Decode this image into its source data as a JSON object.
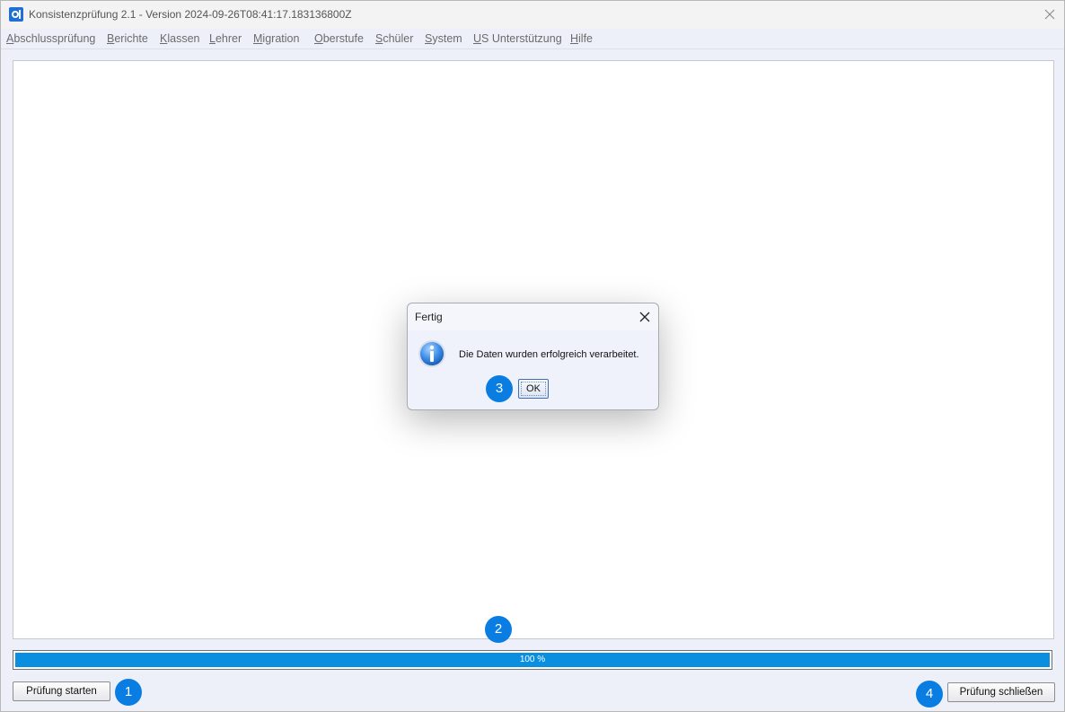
{
  "window": {
    "title": "Konsistenzprüfung 2.1 - Version 2024-09-26T08:41:17.183136800Z"
  },
  "menu": {
    "items": [
      {
        "mnemonic": "A",
        "rest": "bschlussprüfung"
      },
      {
        "mnemonic": "B",
        "rest": "erichte"
      },
      {
        "mnemonic": "K",
        "rest": "lassen"
      },
      {
        "mnemonic": "L",
        "rest": "ehrer"
      },
      {
        "mnemonic": "M",
        "rest": "igration"
      },
      {
        "mnemonic": "O",
        "rest": "berstufe"
      },
      {
        "mnemonic": "S",
        "rest": "chüler"
      },
      {
        "mnemonic": "S",
        "rest": "ystem"
      },
      {
        "mnemonic": "U",
        "rest": "S Unterstützung"
      },
      {
        "mnemonic": "H",
        "rest": "ilfe"
      }
    ]
  },
  "progress": {
    "value": 1.0,
    "label": "100 %",
    "color": "#0a8ee0"
  },
  "buttons": {
    "start": "Prüfung starten",
    "close": "Prüfung schließen"
  },
  "dialog": {
    "title": "Fertig",
    "message": "Die Daten wurden erfolgreich verarbeitet.",
    "ok": "OK",
    "icon": "info-icon"
  },
  "badges": {
    "b1": "1",
    "b2": "2",
    "b3": "3",
    "b4": "4",
    "color": "#0a7de2"
  }
}
